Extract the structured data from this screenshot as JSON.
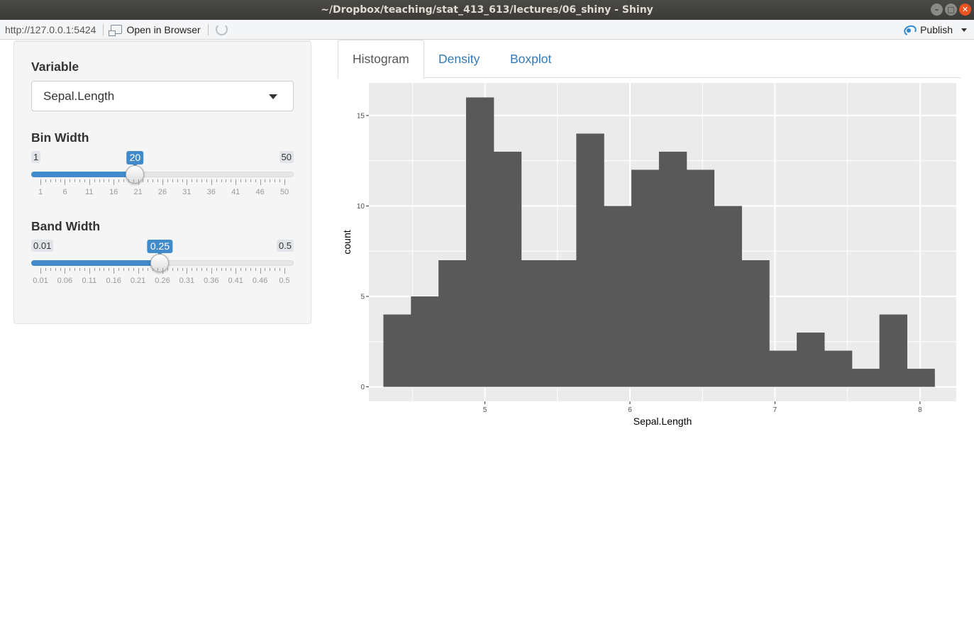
{
  "window": {
    "title": "~/Dropbox/teaching/stat_413_613/lectures/06_shiny - Shiny"
  },
  "toolbar": {
    "url": "http://127.0.0.1:5424",
    "open_browser": "Open in Browser",
    "publish": "Publish"
  },
  "sidebar": {
    "variable_label": "Variable",
    "variable_value": "Sepal.Length",
    "binwidth": {
      "label": "Bin Width",
      "min": "1",
      "max": "50",
      "value": "20",
      "min_num": 1,
      "max_num": 50,
      "value_num": 20,
      "tick_labels": [
        "1",
        "6",
        "11",
        "16",
        "21",
        "26",
        "31",
        "36",
        "41",
        "46",
        "50"
      ]
    },
    "bandwidth": {
      "label": "Band Width",
      "min": "0.01",
      "max": "0.5",
      "value": "0.25",
      "min_num": 0.01,
      "max_num": 0.5,
      "value_num": 0.25,
      "tick_labels": [
        "0.01",
        "0.06",
        "0.11",
        "0.16",
        "0.21",
        "0.26",
        "0.31",
        "0.36",
        "0.41",
        "0.46",
        "0.5"
      ]
    }
  },
  "tabs": [
    "Histogram",
    "Density",
    "Boxplot"
  ],
  "colors": {
    "accent": "#428bca",
    "bar_fill": "#595959",
    "panel_bg": "#ebebeb"
  },
  "chart_data": {
    "type": "bar",
    "xlabel": "Sepal.Length",
    "ylabel": "count",
    "xlim": [
      4.2,
      8.25
    ],
    "ylim": [
      -0.8,
      16.8
    ],
    "x_ticks": [
      5,
      6,
      7,
      8
    ],
    "y_ticks": [
      0,
      5,
      10,
      15
    ],
    "bin_starts": [
      4.3,
      4.49,
      4.68,
      4.87,
      5.06,
      5.25,
      5.44,
      5.63,
      5.82,
      6.01,
      6.2,
      6.39,
      6.58,
      6.77,
      6.96,
      7.15,
      7.34,
      7.53,
      7.72,
      7.91
    ],
    "bin_width": 0.19,
    "values": [
      4,
      5,
      7,
      16,
      13,
      7,
      7,
      14,
      10,
      12,
      13,
      12,
      10,
      7,
      2,
      3,
      2,
      1,
      4,
      1
    ],
    "grid": true
  }
}
